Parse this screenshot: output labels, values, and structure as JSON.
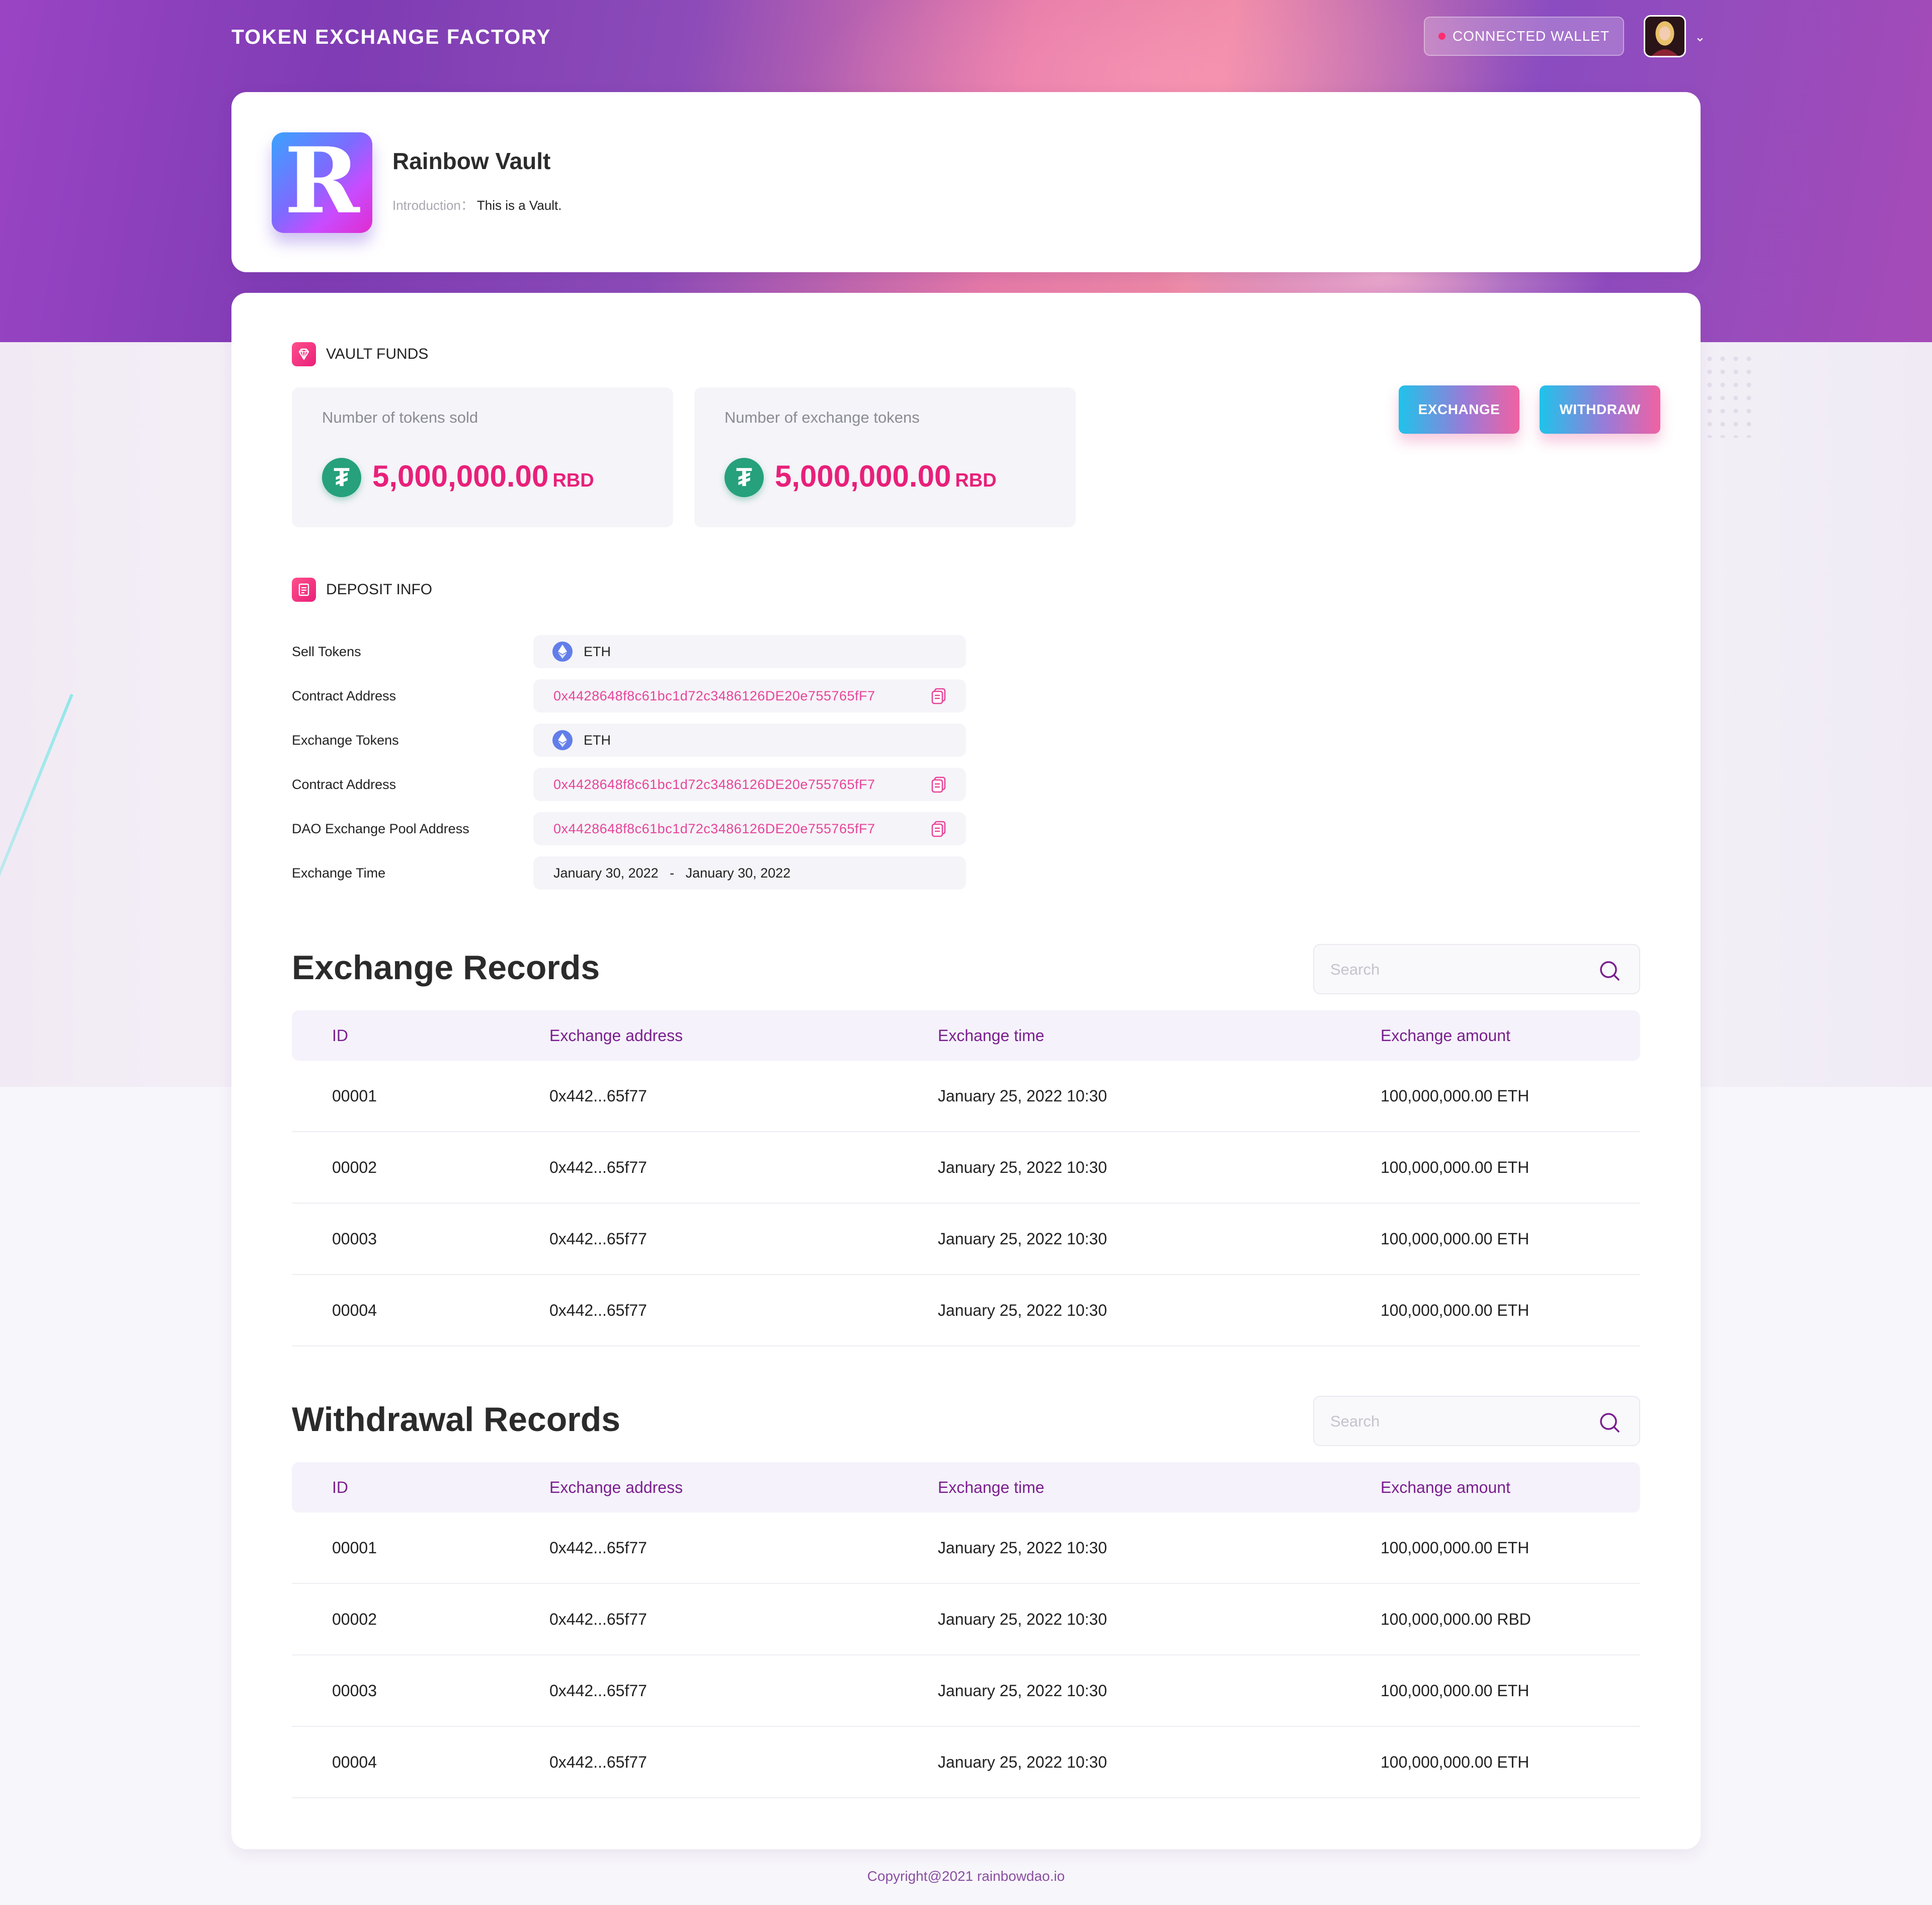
{
  "header": {
    "brand": "TOKEN EXCHANGE FACTORY",
    "wallet_label": "CONNECTED  WALLET"
  },
  "vault": {
    "logo_letter": "R",
    "name": "Rainbow Vault",
    "intro_label": "Introduction：",
    "intro_value": "This is a Vault."
  },
  "funds": {
    "title": "VAULT FUNDS",
    "sold_label": "Number of tokens sold",
    "sold_amount": "5,000,000.00",
    "sold_unit": "RBD",
    "exchange_label": "Number of exchange tokens",
    "exchange_amount": "5,000,000.00",
    "exchange_unit": "RBD",
    "exchange_button": "EXCHANGE",
    "withdraw_button": "WITHDRAW"
  },
  "deposit": {
    "title": "DEPOSIT INFO",
    "rows": [
      {
        "label": "Sell Tokens",
        "value": "ETH"
      },
      {
        "label": "Contract Address",
        "value": "0x4428648f8c61bc1d72c3486126DE20e755765fF7"
      },
      {
        "label": "Exchange Tokens",
        "value": "ETH"
      },
      {
        "label": "Contract Address",
        "value": "0x4428648f8c61bc1d72c3486126DE20e755765fF7"
      },
      {
        "label": "DAO Exchange Pool Address",
        "value": "0x4428648f8c61bc1d72c3486126DE20e755765fF7"
      },
      {
        "label": "Exchange Time",
        "value": "January 30, 2022   -   January 30, 2022"
      }
    ]
  },
  "exchange_records": {
    "title": "Exchange Records",
    "search_placeholder": "Search",
    "columns": [
      "ID",
      "Exchange address",
      "Exchange time",
      "Exchange amount"
    ],
    "rows": [
      [
        "00001",
        "0x442...65f77",
        "January 25, 2022 10:30",
        "100,000,000.00 ETH"
      ],
      [
        "00002",
        "0x442...65f77",
        "January 25, 2022 10:30",
        "100,000,000.00 ETH"
      ],
      [
        "00003",
        "0x442...65f77",
        "January 25, 2022 10:30",
        "100,000,000.00 ETH"
      ],
      [
        "00004",
        "0x442...65f77",
        "January 25, 2022 10:30",
        "100,000,000.00 ETH"
      ]
    ]
  },
  "withdrawal_records": {
    "title": "Withdrawal Records",
    "search_placeholder": "Search",
    "columns": [
      "ID",
      "Exchange address",
      "Exchange time",
      "Exchange amount"
    ],
    "rows": [
      [
        "00001",
        "0x442...65f77",
        "January 25, 2022 10:30",
        "100,000,000.00 ETH"
      ],
      [
        "00002",
        "0x442...65f77",
        "January 25, 2022 10:30",
        "100,000,000.00 RBD"
      ],
      [
        "00003",
        "0x442...65f77",
        "January 25, 2022 10:30",
        "100,000,000.00 ETH"
      ],
      [
        "00004",
        "0x442...65f77",
        "January 25, 2022 10:30",
        "100,000,000.00 ETH"
      ]
    ]
  },
  "footer": {
    "copyright": "Copyright@2021 rainbowdao.io"
  },
  "colors": {
    "accent": "#e8207a",
    "table_header": "#7a1f8e",
    "tether": "#26a17b",
    "eth": "#627eea"
  },
  "icons": [
    "diamond-icon",
    "document-icon",
    "tether-icon",
    "eth-icon",
    "copy-icon",
    "search-icon",
    "chevron-down-icon"
  ]
}
